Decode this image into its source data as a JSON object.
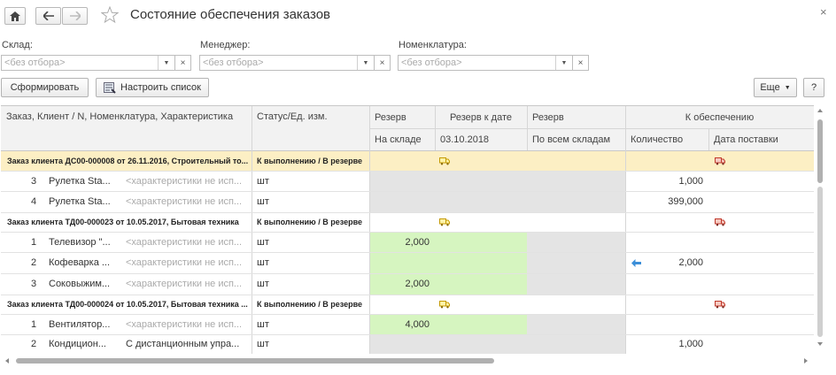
{
  "window": {
    "title": "Состояние обеспечения заказов",
    "close": "×"
  },
  "filters": {
    "warehouse": {
      "label": "Склад:",
      "placeholder": "<без отбора>"
    },
    "manager": {
      "label": "Менеджер:",
      "placeholder": "<без отбора>"
    },
    "nomenclature": {
      "label": "Номенклатура:",
      "placeholder": "<без отбора>"
    }
  },
  "toolbar": {
    "generate": "Сформировать",
    "configure": "Настроить список",
    "more": "Еще",
    "help": "?"
  },
  "columns": {
    "order": "Заказ, Клиент / N, Номенклатура, Характеристика",
    "status": "Статус/Ед. изм.",
    "reserve1": "Резерв",
    "reserve_date_title": "Резерв к дате",
    "reserve2": "Резерв",
    "provision": "К обеспечению",
    "on_warehouse": "На складе",
    "reserve_date": "03.10.2018",
    "all_warehouses": "По всем складам",
    "quantity": "Количество",
    "delivery_date": "Дата поставки"
  },
  "rows": [
    {
      "type": "group",
      "order": "Заказ клиента ДС00-000008 от 26.11.2016, Строительный то...",
      "status": "К выполнению / В резерве"
    },
    {
      "type": "item",
      "n": "3",
      "name": "Рулетка Sta...",
      "char": "<характеристики не исп...",
      "unit": "шт",
      "stock": "",
      "qty": "1,000"
    },
    {
      "type": "item",
      "n": "4",
      "name": "Рулетка Sta...",
      "char": "<характеристики не исп...",
      "unit": "шт",
      "stock": "",
      "qty": "399,000"
    },
    {
      "type": "group",
      "order": "Заказ клиента ТД00-000023 от 10.05.2017, Бытовая техника",
      "status": "К выполнению / В резерве"
    },
    {
      "type": "item",
      "n": "1",
      "name": "Телевизор \"...",
      "char": "<характеристики не исп...",
      "unit": "шт",
      "stock": "2,000",
      "qty": ""
    },
    {
      "type": "item",
      "n": "2",
      "name": "Кофеварка ...",
      "char": "<характеристики не исп...",
      "unit": "шт",
      "stock": "",
      "qty": "2,000"
    },
    {
      "type": "item",
      "n": "3",
      "name": "Соковыжим...",
      "char": "<характеристики не исп...",
      "unit": "шт",
      "stock": "2,000",
      "qty": ""
    },
    {
      "type": "group",
      "order": "Заказ клиента ТД00-000024 от 10.05.2017, Бытовая техника ...",
      "status": "К выполнению / В резерве"
    },
    {
      "type": "item",
      "n": "1",
      "name": "Вентилятор...",
      "char": "<характеристики не исп...",
      "unit": "шт",
      "stock": "4,000",
      "qty": ""
    },
    {
      "type": "item",
      "n": "2",
      "name": "Кондицион...",
      "char": "С дистанционным упра...",
      "unit": "шт",
      "stock": "",
      "qty": "1,000"
    }
  ],
  "colors": {
    "selected_row": "#fcefc4",
    "reserve_green": "#d6f5c0",
    "empty_grey": "#e4e4e4",
    "accent_arrow": "#3b8ed8"
  }
}
